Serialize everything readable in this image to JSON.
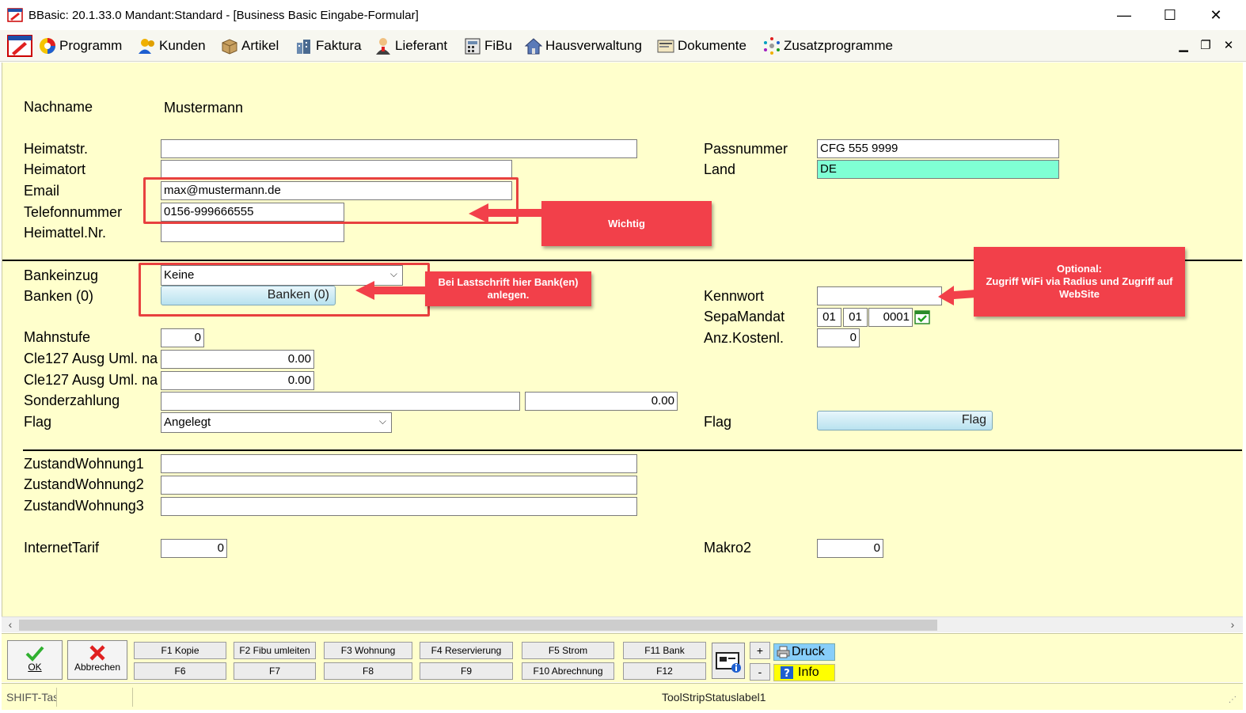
{
  "window": {
    "title": "BBasic: 20.1.33.0 Mandant:Standard  - [Business Basic Eingabe-Formular]",
    "minimize": "—",
    "maximize": "☐",
    "close": "✕"
  },
  "menu": {
    "items": [
      {
        "label": "Programm",
        "icon": "programm-icon"
      },
      {
        "label": "Kunden",
        "icon": "kunden-icon"
      },
      {
        "label": "Artikel",
        "icon": "artikel-icon"
      },
      {
        "label": "Faktura",
        "icon": "faktura-icon"
      },
      {
        "label": "Lieferant",
        "icon": "lieferant-icon"
      },
      {
        "label": "FiBu",
        "icon": "fibu-icon"
      },
      {
        "label": "Hausverwaltung",
        "icon": "hausverwaltung-icon"
      },
      {
        "label": "Dokumente",
        "icon": "dokumente-icon"
      },
      {
        "label": "Zusatzprogramme",
        "icon": "zusatzprogramme-icon"
      }
    ],
    "mdi_min": "▁",
    "mdi_restore": "❐",
    "mdi_close": "✕"
  },
  "form": {
    "nachname_label": "Nachname",
    "nachname_value": "Mustermann",
    "heimatstr_label": "Heimatstr.",
    "heimatstr_value": "",
    "heimatort_label": "Heimatort",
    "heimatort_value": "",
    "email_label": "Email",
    "email_value": "max@mustermann.de",
    "telefon_label": "Telefonnummer",
    "telefon_value": "0156-999666555",
    "heimattel_label": "Heimattel.Nr.",
    "heimattel_value": "",
    "passnummer_label": "Passnummer",
    "passnummer_value": "CFG 555 9999",
    "land_label": "Land",
    "land_value": "DE",
    "bankeinzug_label": "Bankeinzug",
    "bankeinzug_value": "Keine",
    "banken_label": "Banken (0)",
    "banken_button": "Banken (0)",
    "kennwort_label": "Kennwort",
    "kennwort_value": "",
    "sepamandat_label": "SepaMandat",
    "sepa_day": "01",
    "sepa_month": "01",
    "sepa_year": "0001",
    "mahnstufe_label": "Mahnstufe",
    "mahnstufe_value": "0",
    "ankostenl_label": "Anz.Kostenl.",
    "ankostenl_value": "0",
    "cle1_label": "Cle127 Ausg Uml. na",
    "cle1_value": "0.00",
    "cle2_label": "Cle127 Ausg Uml. na",
    "cle2_value": "0.00",
    "sonderzahlung_label": "Sonderzahlung",
    "sonderzahlung_text": "",
    "sonderzahlung_value": "0.00",
    "flag_label": "Flag",
    "flag_value": "Angelegt",
    "flag2_label": "Flag",
    "flag2_button": "Flag",
    "zustand1_label": "ZustandWohnung1",
    "zustand1_value": "",
    "zustand2_label": "ZustandWohnung2",
    "zustand2_value": "",
    "zustand3_label": "ZustandWohnung3",
    "zustand3_value": "",
    "internettarif_label": "InternetTarif",
    "internettarif_value": "0",
    "makro2_label": "Makro2",
    "makro2_value": "0"
  },
  "annotations": {
    "wichtig": "Wichtig",
    "bank_note": "Bei Lastschrift hier Bank(en) anlegen.",
    "optional_title": "Optional:",
    "optional_text": "Zugriff WiFi via Radius und Zugriff auf WebSite",
    "color": "#f2404a"
  },
  "toolbar": {
    "ok": "OK",
    "abbrechen": "Abbrechen",
    "f1": "F1 Kopie",
    "f2": "F2 Fibu umleiten",
    "f3": "F3 Wohnung",
    "f4": "F4 Reservierung",
    "f5": "F5 Strom",
    "f11": "F11 Bank",
    "f6": "F6",
    "f7": "F7",
    "f8": "F8",
    "f9": "F9",
    "f10": "F10 Abrechnung",
    "f12": "F12",
    "plus": "+",
    "minus": "-",
    "druck": "Druck",
    "info": "Info"
  },
  "status": {
    "shift": "SHIFT-Tas",
    "label1": "ToolStripStatuslabel1"
  },
  "colors": {
    "form_bg": "#ffffcc",
    "cyan_field": "#7fffd4",
    "druck_bg": "#87cefa",
    "info_bg": "#ffff00"
  }
}
